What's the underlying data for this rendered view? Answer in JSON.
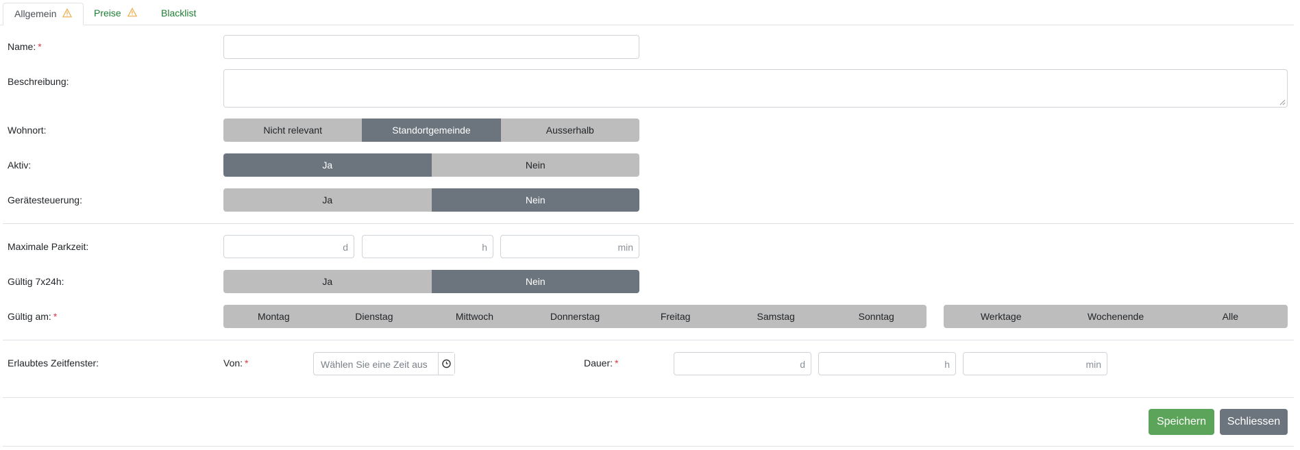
{
  "tabs": [
    {
      "label": "Allgemein",
      "warning": true,
      "active": true
    },
    {
      "label": "Preise",
      "warning": true,
      "active": false
    },
    {
      "label": "Blacklist",
      "warning": false,
      "active": false
    }
  ],
  "form": {
    "name": {
      "label": "Name:",
      "required": "*",
      "value": ""
    },
    "beschreibung": {
      "label": "Beschreibung:",
      "value": ""
    },
    "wohnort": {
      "label": "Wohnort:",
      "options": [
        "Nicht relevant",
        "Standortgemeinde",
        "Ausserhalb"
      ],
      "selected": "Standortgemeinde"
    },
    "aktiv": {
      "label": "Aktiv:",
      "options": [
        "Ja",
        "Nein"
      ],
      "selected": "Ja"
    },
    "geraetesteuerung": {
      "label": "Gerätesteuerung:",
      "options": [
        "Ja",
        "Nein"
      ],
      "selected": "Nein"
    },
    "max_parkzeit": {
      "label": "Maximale Parkzeit:",
      "units": [
        "d",
        "h",
        "min"
      ]
    },
    "gueltig_7x24": {
      "label": "Gültig 7x24h:",
      "options": [
        "Ja",
        "Nein"
      ],
      "selected": "Nein"
    },
    "gueltig_am": {
      "label": "Gültig am:",
      "required": "*",
      "days": [
        "Montag",
        "Dienstag",
        "Mittwoch",
        "Donnerstag",
        "Freitag",
        "Samstag",
        "Sonntag"
      ],
      "groups": [
        "Werktage",
        "Wochenende",
        "Alle"
      ]
    },
    "zeitfenster": {
      "label": "Erlaubtes Zeitfenster:",
      "von_label": "Von:",
      "required": "*",
      "von_placeholder": "Wählen Sie eine Zeit aus",
      "dauer_label": "Dauer:",
      "dauer_units": [
        "d",
        "h",
        "min"
      ]
    }
  },
  "actions": {
    "save": "Speichern",
    "close": "Schliessen"
  },
  "colors": {
    "selected": "#6c757d",
    "unselected": "#bdbdbd",
    "save": "#5ca45a",
    "required": "#dc3545",
    "warning": "#f0ad4e",
    "tab_link": "#1e7e34"
  }
}
